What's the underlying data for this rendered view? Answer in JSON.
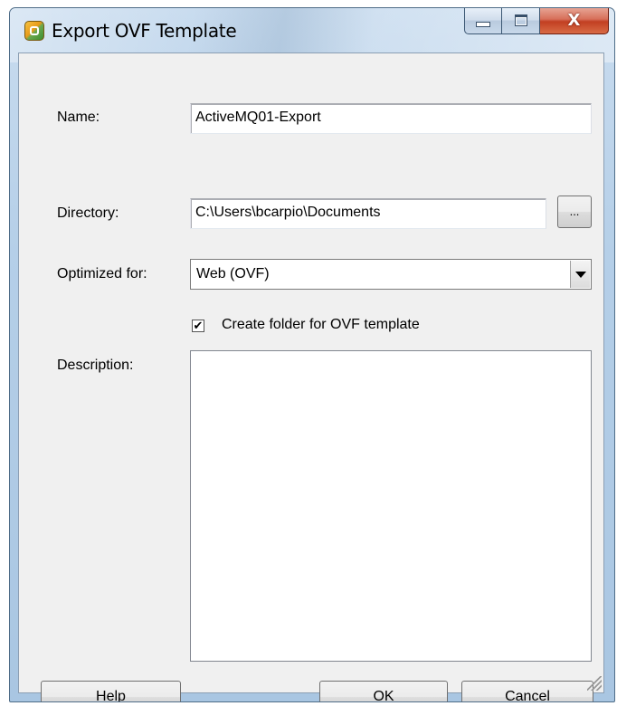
{
  "window": {
    "title": "Export OVF Template",
    "icon": "vsphere-app-icon",
    "caption_buttons": {
      "minimize_icon": "minimize-icon",
      "maximize_icon": "maximize-icon",
      "close_glyph": "X"
    }
  },
  "form": {
    "name_label": "Name:",
    "name_value": "ActiveMQ01-Export",
    "directory_label": "Directory:",
    "directory_value": "C:\\Users\\bcarpio\\Documents",
    "browse_label": "...",
    "optimized_label": "Optimized for:",
    "optimized_value": "Web (OVF)",
    "create_folder_label": "Create folder for OVF template",
    "create_folder_checked": true,
    "check_glyph": "✔",
    "description_label": "Description:",
    "description_value": ""
  },
  "buttons": {
    "help": "Help",
    "ok": "OK",
    "cancel": "Cancel"
  }
}
